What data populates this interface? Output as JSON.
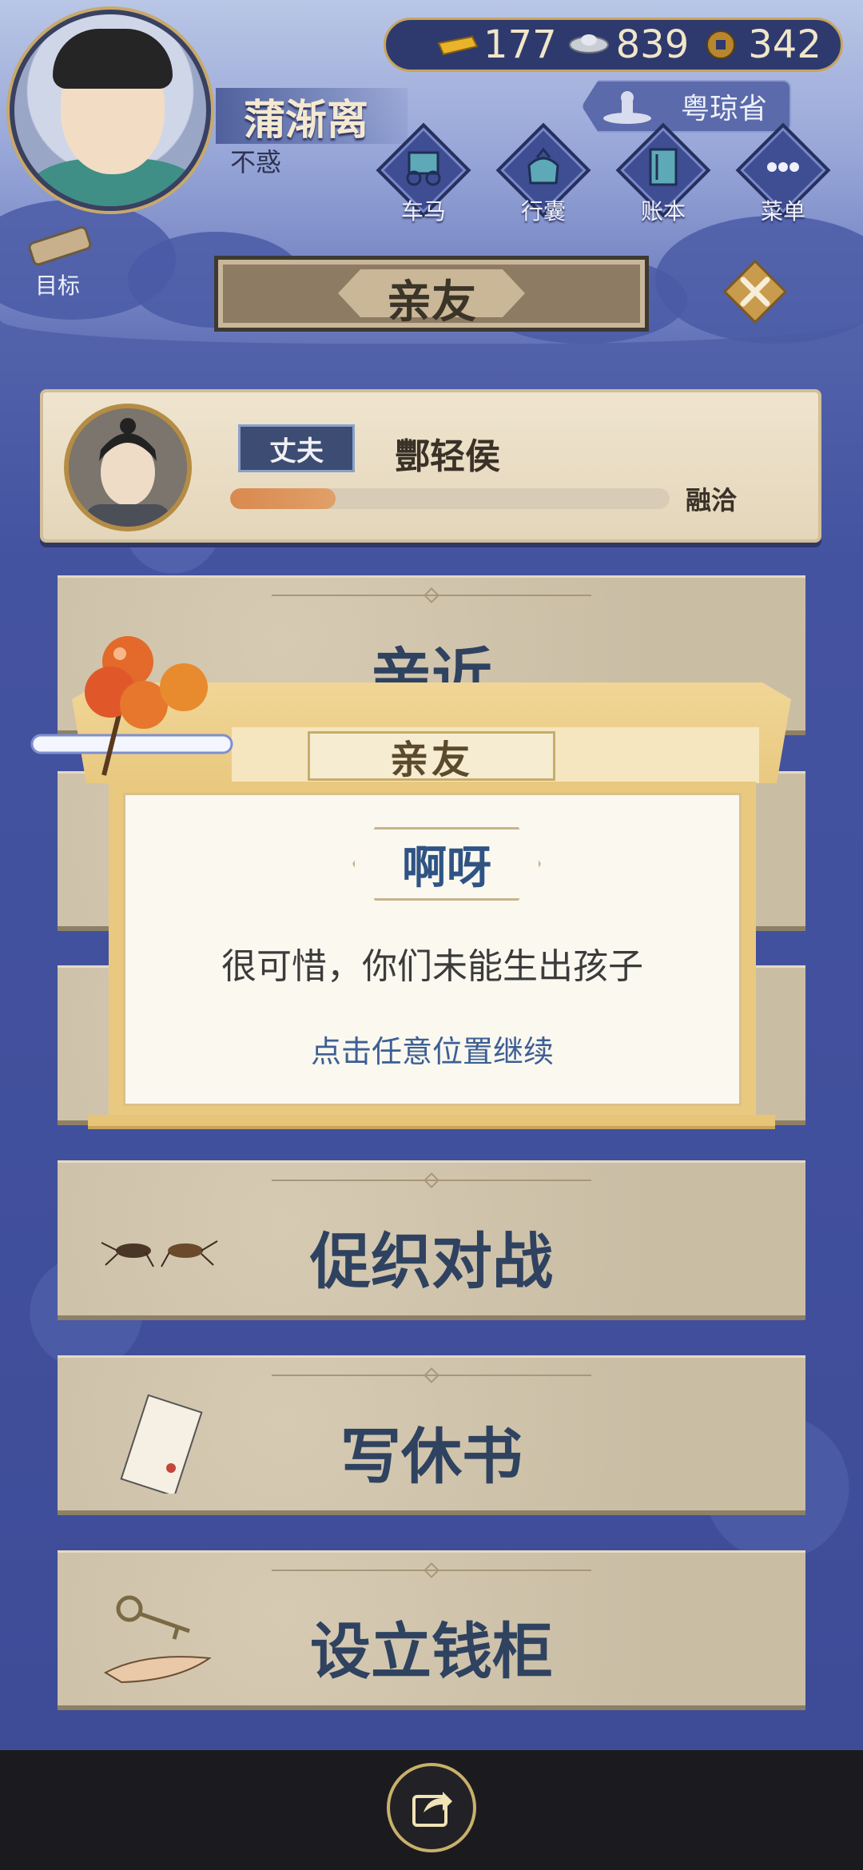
{
  "player": {
    "name": "蒲渐离",
    "age_title": "不惑"
  },
  "currency": {
    "gold": "177",
    "silver": "839",
    "coins": "342"
  },
  "province": "粤琼省",
  "menu": [
    {
      "label": "车马",
      "icon": "carriage-icon"
    },
    {
      "label": "行囊",
      "icon": "bundle-icon"
    },
    {
      "label": "账本",
      "icon": "ledger-icon"
    },
    {
      "label": "菜单",
      "icon": "more-icon"
    }
  ],
  "goal_label": "目标",
  "page_title": "亲友",
  "spouse": {
    "role": "丈夫",
    "name": "酆轻侯",
    "affinity_label": "融洽",
    "affinity_level": 0.24
  },
  "actions": [
    {
      "label": "亲近",
      "icon": ""
    },
    {
      "label": "",
      "icon": ""
    },
    {
      "label": "",
      "icon": ""
    },
    {
      "label": "促织对战",
      "icon": "cricket-icon"
    },
    {
      "label": "写休书",
      "icon": "divorce-letter-icon"
    },
    {
      "label": "设立钱柜",
      "icon": "key-hand-icon"
    }
  ],
  "popup": {
    "header": "亲友",
    "title": "啊呀",
    "message": "很可惜，你们未能生出孩子",
    "hint": "点击任意位置继续"
  },
  "colors": {
    "accent": "#c9a45a",
    "title_blue": "#2f5484",
    "affinity": "#d9894f"
  }
}
